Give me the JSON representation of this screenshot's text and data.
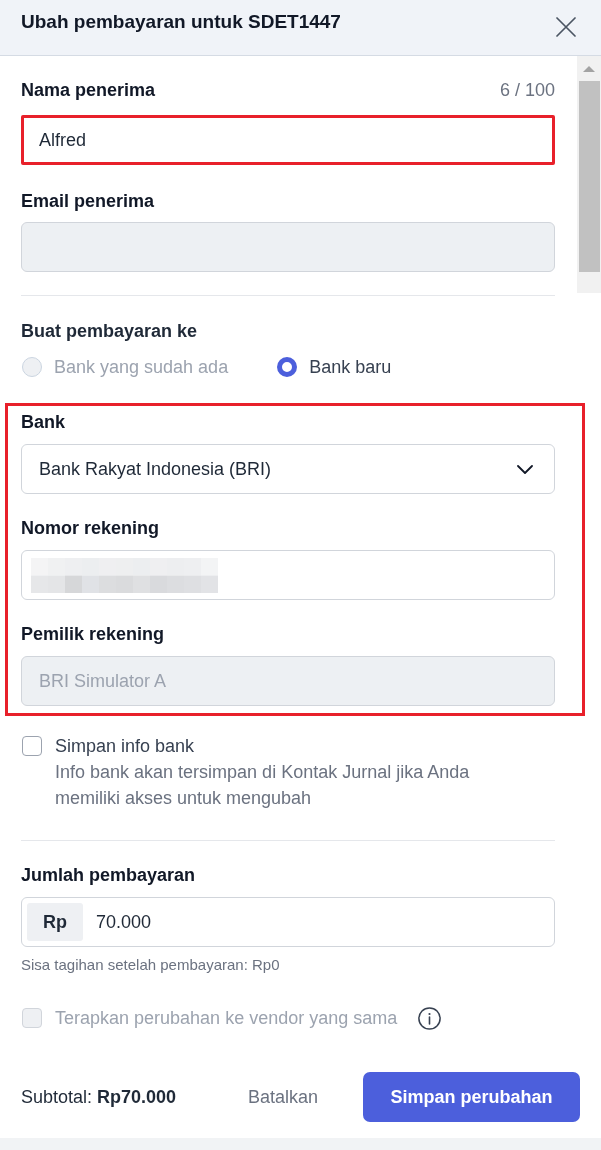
{
  "dialog": {
    "title": "Ubah pembayaran untuk SDET1447"
  },
  "recipient_name": {
    "label": "Nama penerima",
    "counter": "6 / 100",
    "value": "Alfred",
    "highlighted": true
  },
  "recipient_email": {
    "label": "Email penerima",
    "disabled": true
  },
  "payment_target": {
    "label": "Buat pembayaran ke",
    "options": [
      {
        "label": "Bank yang sudah ada",
        "selected": false,
        "disabled": true
      },
      {
        "label": "Bank baru",
        "selected": true,
        "disabled": false
      }
    ]
  },
  "bank_section": {
    "highlighted": true,
    "fields": [
      {
        "kind": "select",
        "label": "Bank",
        "value": "Bank Rakyat Indonesia (BRI)"
      },
      {
        "kind": "redacted",
        "label": "Nomor rekening"
      },
      {
        "kind": "readonly",
        "label": "Pemilik rekening",
        "value": "BRI Simulator A",
        "disabled": true
      }
    ]
  },
  "save_bank_info": {
    "label": "Simpan info bank",
    "description": "Info bank akan tersimpan di Kontak Jurnal jika Anda memiliki akses untuk mengubah",
    "checked": false,
    "disabled": false
  },
  "payment_amount": {
    "label": "Jumlah pembayaran",
    "prefix": "Rp",
    "value": "70.000",
    "hint": "Sisa tagihan setelah pembayaran: Rp0"
  },
  "apply_to_vendor": {
    "label": "Terapkan perubahan ke vendor yang sama",
    "checked": false,
    "disabled": true
  },
  "footer": {
    "subtotal": "Subtotal: **Rp70.000**",
    "buttons": [
      {
        "kind": "text",
        "label": "Batalkan"
      },
      {
        "kind": "primary",
        "label": "Simpan perubahan"
      }
    ]
  }
}
